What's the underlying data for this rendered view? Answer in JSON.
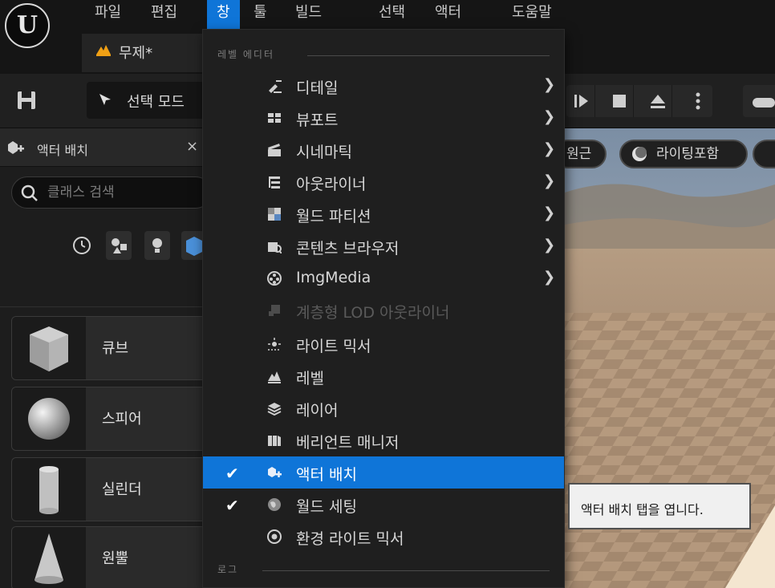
{
  "menubar": {
    "items": [
      {
        "label": "파일",
        "active": false
      },
      {
        "label": "편집",
        "active": false
      },
      {
        "label": "창",
        "active": true
      },
      {
        "label": "툴",
        "active": false
      },
      {
        "label": "빌드",
        "active": false
      },
      {
        "label": "선택",
        "active": false
      },
      {
        "label": "액터",
        "active": false
      },
      {
        "label": "도움말",
        "active": false
      }
    ]
  },
  "document_tab": {
    "label": "무제*",
    "icon": "level-icon"
  },
  "toolbar": {
    "mode_label": "선택 모드",
    "save_icon": "save-icon"
  },
  "left_panel": {
    "tab_label": "액터 배치",
    "close_glyph": "×",
    "search_placeholder": "클래스 검색",
    "filter_icons": [
      "clock-icon",
      "shapes-icon",
      "light-icon",
      "volume-icon"
    ],
    "actors": [
      {
        "label": "큐브",
        "icon": "cube-icon"
      },
      {
        "label": "스피어",
        "icon": "sphere-icon"
      },
      {
        "label": "실린더",
        "icon": "cylinder-icon"
      },
      {
        "label": "원뿔",
        "icon": "cone-icon"
      }
    ]
  },
  "viewport": {
    "pills": [
      {
        "label": "원근"
      },
      {
        "label": "라이팅포함"
      }
    ]
  },
  "window_menu": {
    "section_level_editor": "레벨 에디터",
    "section_log": "로그",
    "items": [
      {
        "label": "디테일",
        "icon": "details-icon",
        "submenu": true,
        "checked": false,
        "disabled": false,
        "selected": false
      },
      {
        "label": "뷰포트",
        "icon": "viewport-icon",
        "submenu": true,
        "checked": false,
        "disabled": false,
        "selected": false
      },
      {
        "label": "시네마틱",
        "icon": "clapper-icon",
        "submenu": true,
        "checked": false,
        "disabled": false,
        "selected": false
      },
      {
        "label": "아웃라이너",
        "icon": "outliner-icon",
        "submenu": true,
        "checked": false,
        "disabled": false,
        "selected": false
      },
      {
        "label": "월드 파티션",
        "icon": "world-partition-icon",
        "submenu": true,
        "checked": false,
        "disabled": false,
        "selected": false
      },
      {
        "label": "콘텐츠 브라우저",
        "icon": "content-browser-icon",
        "submenu": true,
        "checked": false,
        "disabled": false,
        "selected": false
      },
      {
        "label": "ImgMedia",
        "icon": "film-reel-icon",
        "submenu": true,
        "checked": false,
        "disabled": false,
        "selected": false
      },
      {
        "label": "계층형 LOD 아웃라이너",
        "icon": "hlod-icon",
        "submenu": false,
        "checked": false,
        "disabled": true,
        "selected": false
      },
      {
        "label": "라이트 믹서",
        "icon": "light-mixer-icon",
        "submenu": false,
        "checked": false,
        "disabled": false,
        "selected": false
      },
      {
        "label": "레벨",
        "icon": "level-icon",
        "submenu": false,
        "checked": false,
        "disabled": false,
        "selected": false
      },
      {
        "label": "레이어",
        "icon": "layers-icon",
        "submenu": false,
        "checked": false,
        "disabled": false,
        "selected": false
      },
      {
        "label": "베리언트 매니저",
        "icon": "variant-icon",
        "submenu": false,
        "checked": false,
        "disabled": false,
        "selected": false
      },
      {
        "label": "액터 배치",
        "icon": "place-actors-icon",
        "submenu": false,
        "checked": true,
        "disabled": false,
        "selected": true
      },
      {
        "label": "월드 세팅",
        "icon": "globe-icon",
        "submenu": false,
        "checked": true,
        "disabled": false,
        "selected": false
      },
      {
        "label": "환경 라이트 믹서",
        "icon": "env-light-icon",
        "submenu": false,
        "checked": false,
        "disabled": false,
        "selected": false
      }
    ],
    "check_glyph": "✔",
    "arrow_glyph": "❯"
  },
  "tooltip": {
    "text": "액터 배치 탭을 엽니다."
  },
  "colors": {
    "accent": "#0f75d8",
    "background": "#151515",
    "panel": "#1f1f1f"
  }
}
